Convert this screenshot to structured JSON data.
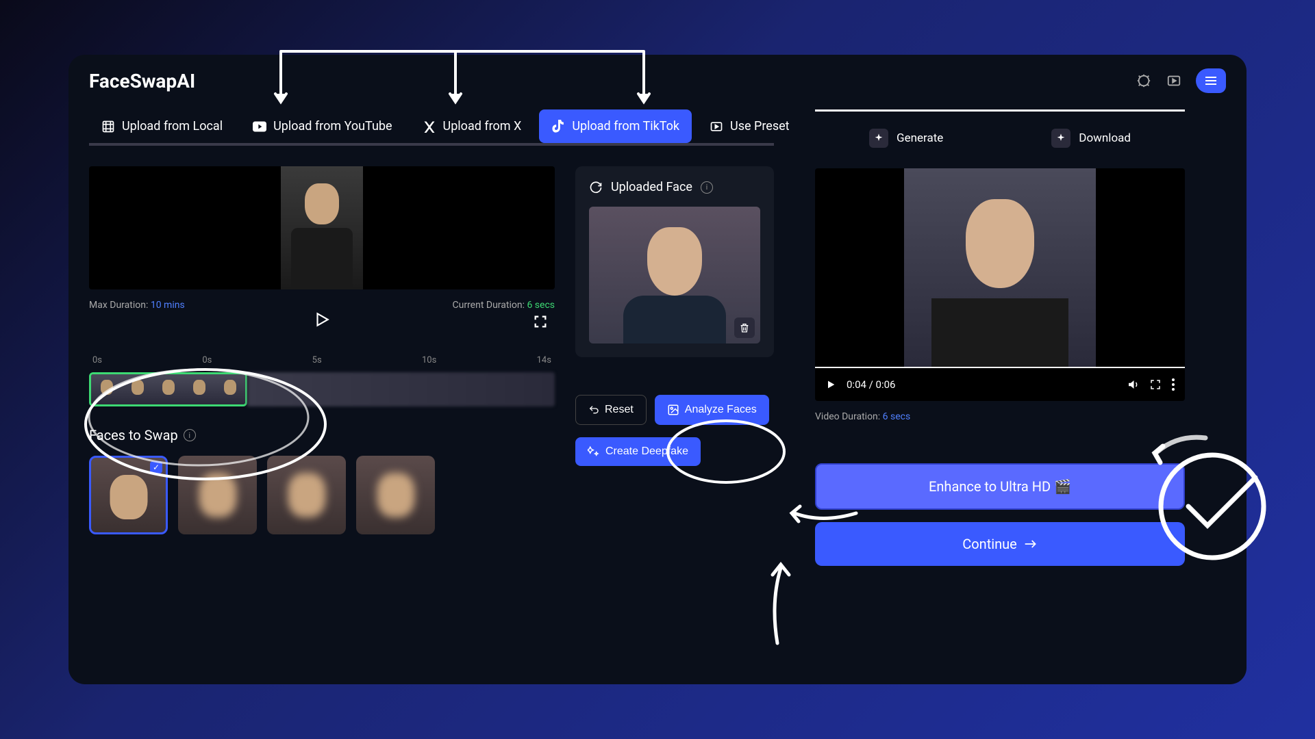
{
  "brand": "FaceSwapAI",
  "tabs": {
    "local": "Upload from Local",
    "youtube": "Upload from YouTube",
    "x": "Upload from X",
    "tiktok": "Upload from TikTok",
    "preset": "Use Preset"
  },
  "duration": {
    "maxLabel": "Max Duration:",
    "maxVal": "10 mins",
    "curLabel": "Current Duration:",
    "curVal": "6 secs"
  },
  "timeline": {
    "ticks": [
      "0s",
      "0s",
      "5s",
      "10s",
      "14s"
    ]
  },
  "uploaded": {
    "title": "Uploaded Face"
  },
  "actions": {
    "reset": "Reset",
    "analyze": "Analyze Faces",
    "create": "Create Deepfake"
  },
  "facesTitle": "Faces to Swap",
  "rightTabs": {
    "generate": "Generate",
    "download": "Download"
  },
  "videoTime": "0:04 / 0:06",
  "vidDurLabel": "Video Duration:",
  "vidDurVal": "6 secs",
  "enhance": "Enhance to Ultra HD 🎬",
  "continue": "Continue"
}
